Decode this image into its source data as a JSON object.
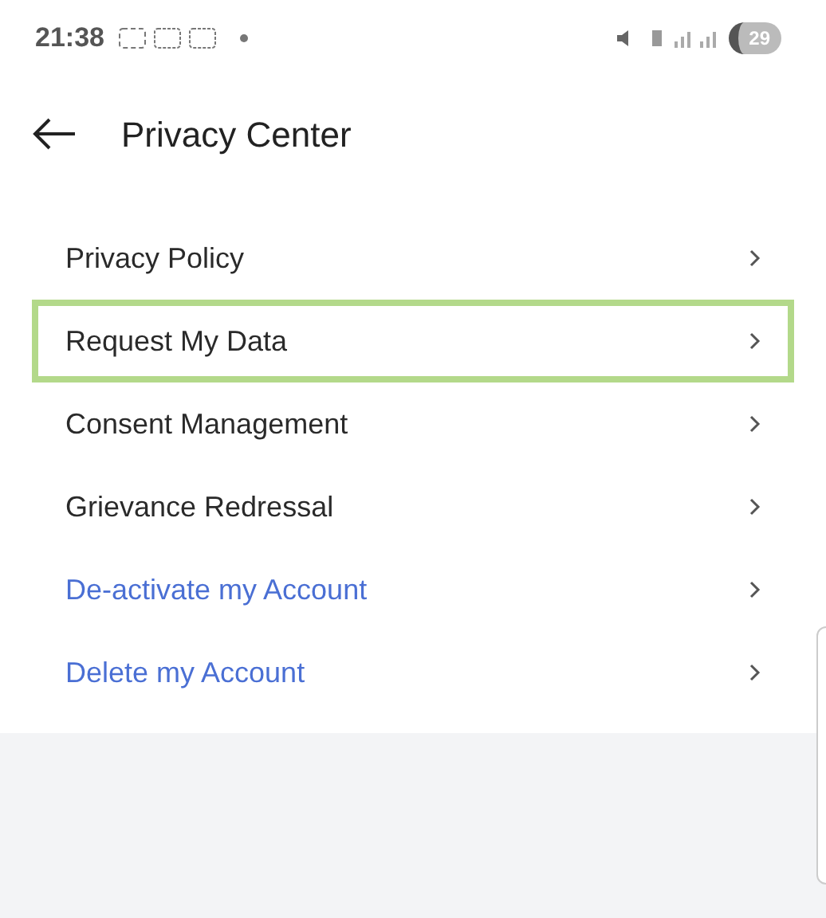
{
  "status_bar": {
    "time": "21:38",
    "battery": "29"
  },
  "header": {
    "title": "Privacy Center"
  },
  "menu_items": [
    {
      "label": "Privacy Policy",
      "kind": "default",
      "selected": false
    },
    {
      "label": "Request My Data",
      "kind": "default",
      "selected": true
    },
    {
      "label": "Consent Management",
      "kind": "default",
      "selected": false
    },
    {
      "label": "Grievance Redressal",
      "kind": "default",
      "selected": false
    },
    {
      "label": "De-activate my Account",
      "kind": "action",
      "selected": false
    },
    {
      "label": "Delete my Account",
      "kind": "action",
      "selected": false
    }
  ]
}
